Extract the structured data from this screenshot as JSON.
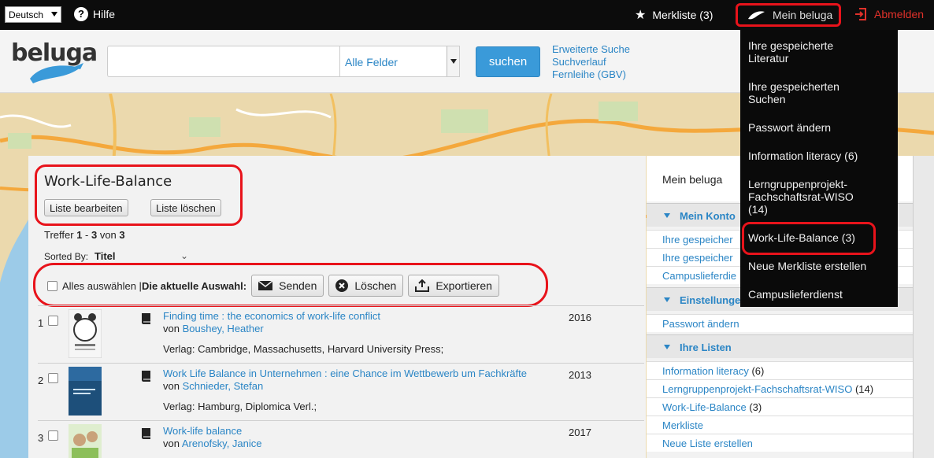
{
  "topbar": {
    "language": "Deutsch",
    "help": "Hilfe",
    "merkliste": "Merkliste (3)",
    "mein_beluga": "Mein beluga",
    "abmelden": "Abmelden"
  },
  "header": {
    "logo": "beluga",
    "search_value": "",
    "field_select": "Alle Felder",
    "search_button": "suchen",
    "links": [
      "Erweiterte Suche",
      "Suchverlauf",
      "Fernleihe (GBV)"
    ]
  },
  "list": {
    "title": "Work-Life-Balance",
    "edit_button": "Liste bearbeiten",
    "delete_button": "Liste löschen",
    "treffer_prefix": "Treffer ",
    "treffer_from": "1",
    "treffer_sep": " - ",
    "treffer_to": "3",
    "treffer_von": " von ",
    "treffer_total": "3",
    "sorted_label": "Sorted By:",
    "sorted_value": "Titel",
    "select_all": "Alles auswählen | ",
    "current_selection": "Die aktuelle Auswahl:",
    "send": "Senden",
    "delete": "Löschen",
    "export": "Exportieren",
    "items": [
      {
        "num": "1",
        "title": "Finding time : the economics of work-life conflict",
        "von": "von ",
        "author": "Boushey, Heather",
        "verlag": "Verlag: Cambridge, Massachusetts, Harvard University Press;",
        "year": "2016"
      },
      {
        "num": "2",
        "title": "Work Life Balance in Unternehmen : eine Chance im Wettbewerb um Fachkräfte",
        "von": "von ",
        "author": "Schnieder, Stefan",
        "verlag": "Verlag: Hamburg, Diplomica Verl.;",
        "year": "2013"
      },
      {
        "num": "3",
        "title": "Work-life balance",
        "von": "von ",
        "author": "Arenofsky, Janice",
        "verlag": "",
        "year": "2017"
      }
    ]
  },
  "sidebar": {
    "heading": "Mein beluga",
    "konto_label": "Mein Konto",
    "konto_items": [
      "Ihre gespeicher",
      "Ihre gespeicher",
      "Campuslieferdie"
    ],
    "einstellungen_label": "Einstellunge",
    "einstellungen_items": [
      "Passwort ändern"
    ],
    "listen_label": "Ihre Listen",
    "listen_items": [
      {
        "label": "Information literacy",
        "count": " (6)"
      },
      {
        "label": "Lerngruppenprojekt-Fachschaftsrat-WISO",
        "count": " (14)"
      },
      {
        "label": "Work-Life-Balance",
        "count": " (3)"
      },
      {
        "label": "Merkliste",
        "count": ""
      },
      {
        "label": "Neue Liste erstellen",
        "count": ""
      }
    ]
  },
  "dropdown": {
    "items": [
      "Ihre gespeicherte Literatur",
      "Ihre gespeicherten Suchen",
      "Passwort ändern",
      "Information literacy (6)",
      "Lerngruppenprojekt-Fachschaftsrat-WISO (14)",
      "Work-Life-Balance (3)",
      "Neue Merkliste erstellen",
      "Campuslieferdienst"
    ]
  },
  "colors": {
    "accent": "#2a85c5",
    "highlight": "#e8131b",
    "topbar": "#0c0c0c"
  }
}
